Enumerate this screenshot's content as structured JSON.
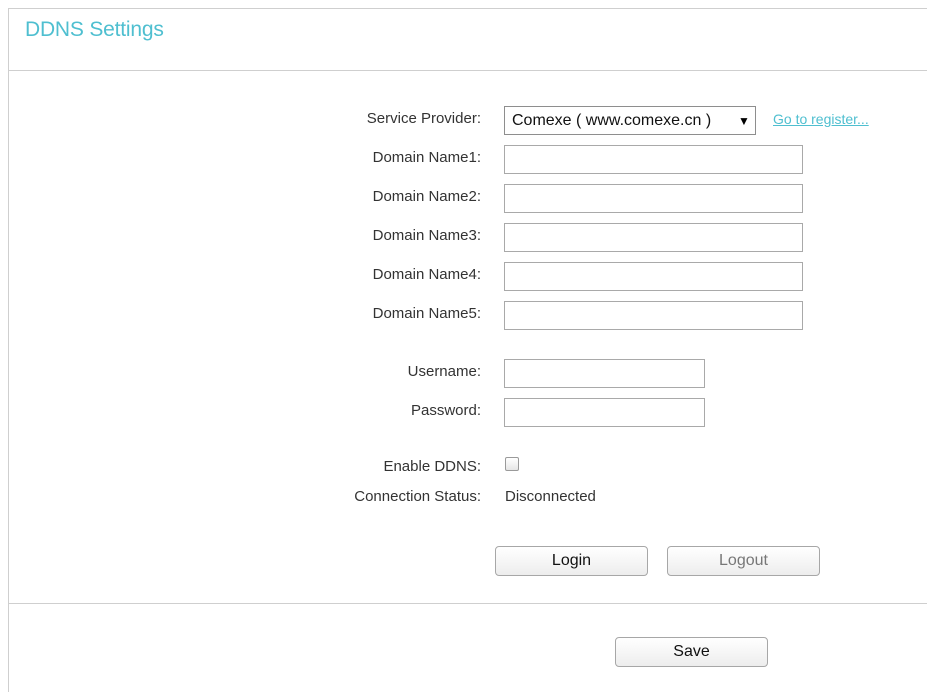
{
  "page": {
    "title": "DDNS Settings"
  },
  "form": {
    "service_provider_label": "Service Provider:",
    "service_provider_value": "Comexe ( www.comexe.cn )",
    "register_link": "Go to register...",
    "domain1_label": "Domain Name1:",
    "domain2_label": "Domain Name2:",
    "domain3_label": "Domain Name3:",
    "domain4_label": "Domain Name4:",
    "domain5_label": "Domain Name5:",
    "domain1_value": "",
    "domain2_value": "",
    "domain3_value": "",
    "domain4_value": "",
    "domain5_value": "",
    "username_label": "Username:",
    "username_value": "",
    "password_label": "Password:",
    "password_value": "",
    "enable_label": "Enable DDNS:",
    "enable_checked": false,
    "status_label": "Connection Status:",
    "status_value": "Disconnected"
  },
  "buttons": {
    "login": "Login",
    "logout": "Logout",
    "save": "Save"
  },
  "colors": {
    "accent": "#4fbfd0",
    "text": "#333333",
    "border": "#cfcfcf"
  },
  "icons": {
    "select_arrow": "dropdown-arrow-icon"
  }
}
